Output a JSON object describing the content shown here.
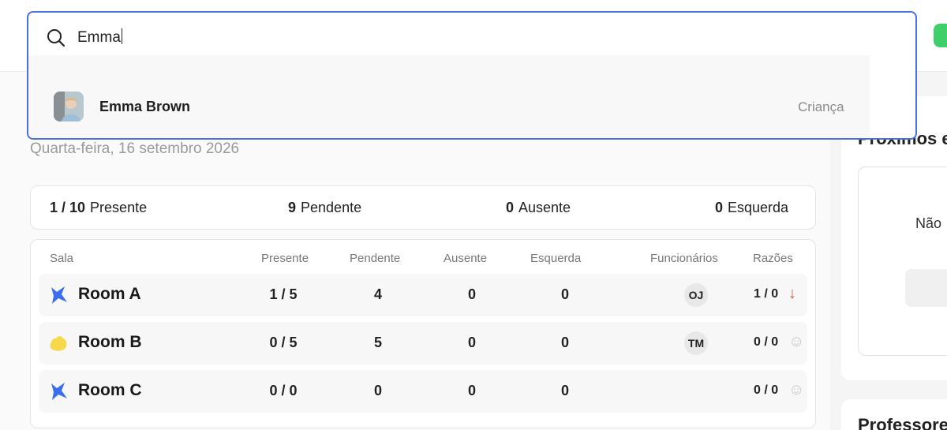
{
  "search": {
    "query": "Emma",
    "results": [
      {
        "name": "Emma Brown",
        "type": "Criança"
      }
    ]
  },
  "date": "Quarta-feira, 16 setembro 2026",
  "summary": {
    "present_value": "1 / 10",
    "present_label": "Presente",
    "pending_value": "9",
    "pending_label": "Pendente",
    "absent_value": "0",
    "absent_label": "Ausente",
    "left_value": "0",
    "left_label": "Esquerda"
  },
  "table": {
    "headers": {
      "room": "Sala",
      "present": "Presente",
      "pending": "Pendente",
      "absent": "Ausente",
      "left": "Esquerda",
      "staff": "Funcionários",
      "ratio": "Razões"
    },
    "rows": [
      {
        "name": "Room A",
        "icon": "blue-splash-icon",
        "color": "#3b6df0",
        "present": "1 / 5",
        "pending": "4",
        "absent": "0",
        "left": "0",
        "staff": "OJ",
        "ratio": "1 / 0",
        "ratio_icon": "↓",
        "ratio_icon_name": "red-arrow-down-icon",
        "ratio_icon_color": "#e0524a"
      },
      {
        "name": "Room B",
        "icon": "yellow-blob-icon",
        "color": "#f5d94a",
        "present": "0 / 5",
        "pending": "5",
        "absent": "0",
        "left": "0",
        "staff": "TM",
        "ratio": "0 / 0",
        "ratio_icon": "☺",
        "ratio_icon_name": "smiley-icon",
        "ratio_icon_color": "#c8c8c8"
      },
      {
        "name": "Room C",
        "icon": "blue-splash-icon",
        "color": "#3b6df0",
        "present": "0 / 0",
        "pending": "0",
        "absent": "0",
        "left": "0",
        "staff": "",
        "ratio": "0 / 0",
        "ratio_icon": "☺",
        "ratio_icon_name": "smiley-icon",
        "ratio_icon_color": "#c8c8c8"
      }
    ]
  },
  "side": {
    "upcoming_title": "Próximos e",
    "upcoming_empty": "Não",
    "teachers_title": "Professore"
  },
  "colors": {
    "accent": "#4a6fe0",
    "green": "#3ecf6b"
  }
}
